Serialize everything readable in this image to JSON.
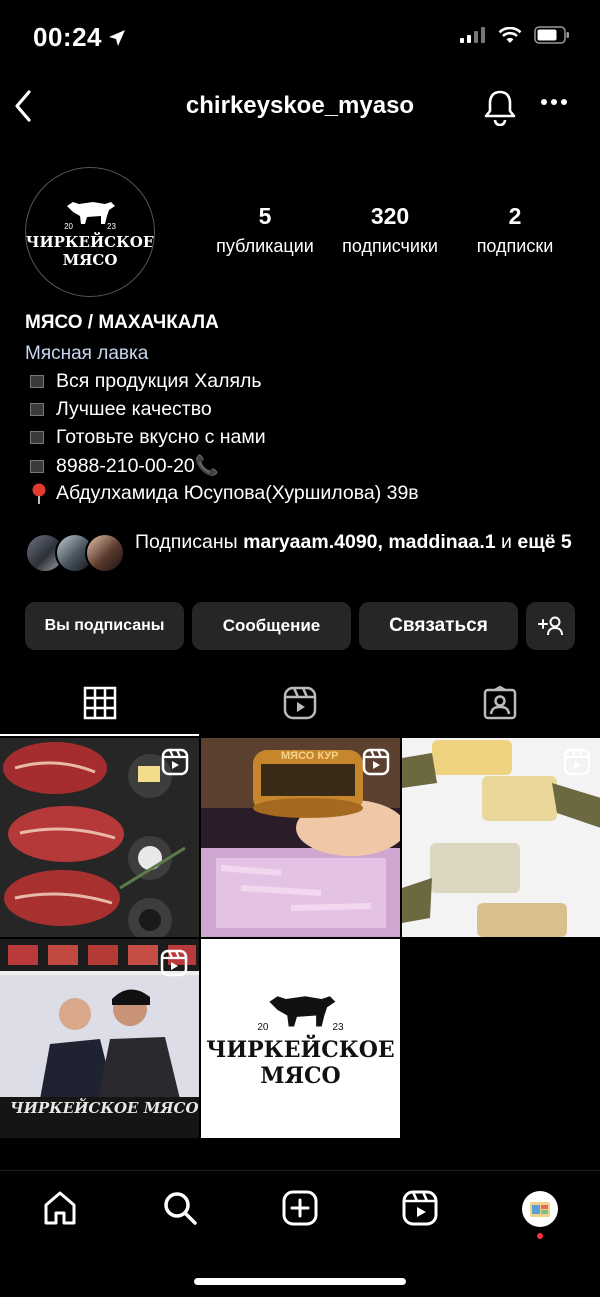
{
  "status": {
    "time": "00:24"
  },
  "header": {
    "username": "chirkeyskoe_myaso"
  },
  "avatar": {
    "line1": "ЧИРКЕЙСКОЕ",
    "line2": "МЯСО",
    "year_left": "20",
    "year_right": "23"
  },
  "stats": [
    {
      "value": "5",
      "label": "публикации"
    },
    {
      "value": "320",
      "label": "подписчики"
    },
    {
      "value": "2",
      "label": "подписки"
    }
  ],
  "bio": {
    "name": "МЯСО / МАХАЧКАЛА",
    "category": "Мясная лавка",
    "lines": [
      "Вся продукция Халяль",
      "Лучшее качество",
      "Готовьте вкусно с нами",
      "8988-210-00-20📞",
      "Абдулхамида Юсупова(Хуршилова) 39в"
    ]
  },
  "followed_by": {
    "prefix": "Подписаны ",
    "names": "maryaam.4090, maddinaa.1",
    "joiner": " и ",
    "more": "ещё 5"
  },
  "buttons": {
    "following": "Вы подписаны",
    "message": "Сообщение",
    "contact": "Связаться"
  },
  "tabs": [
    "grid-icon",
    "reels-icon",
    "tagged-icon"
  ],
  "posts": [
    {
      "type": "reel",
      "icon": "reel-badge-icon"
    },
    {
      "type": "reel",
      "icon": "reel-badge-icon",
      "label": "МЯСО КУР"
    },
    {
      "type": "reel",
      "icon": "reel-badge-icon"
    },
    {
      "type": "reel",
      "icon": "reel-badge-icon",
      "sign": "ЧИРКЕЙСКОЕ МЯСО"
    },
    {
      "type": "image",
      "line1": "ЧИРКЕЙСКОЕ",
      "line2": "МЯСО",
      "year_left": "20",
      "year_right": "23"
    }
  ],
  "nav": [
    "home-icon",
    "search-icon",
    "create-icon",
    "reels-icon",
    "profile-avatar"
  ],
  "colors": {
    "background": "#000000",
    "button": "#262626",
    "category": "#c8d6f0",
    "notification_dot": "#ff3040"
  }
}
